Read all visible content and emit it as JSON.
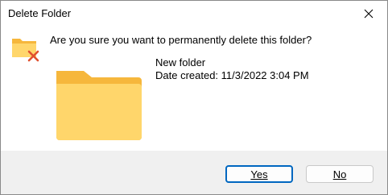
{
  "window": {
    "title": "Delete Folder",
    "close_icon": "close-icon"
  },
  "message": {
    "question": "Are you sure you want to permanently delete this folder?",
    "icon": "delete-folder-icon"
  },
  "item": {
    "name": "New folder",
    "date_created": "Date created: 11/3/2022 3:04 PM",
    "icon": "folder-icon"
  },
  "buttons": {
    "yes_label": "Yes",
    "no_label": "No"
  },
  "colors": {
    "accent": "#0067c0",
    "folder_back": "#f6b73c",
    "folder_front": "#ffd66b",
    "delete_x": "#e0502f"
  }
}
